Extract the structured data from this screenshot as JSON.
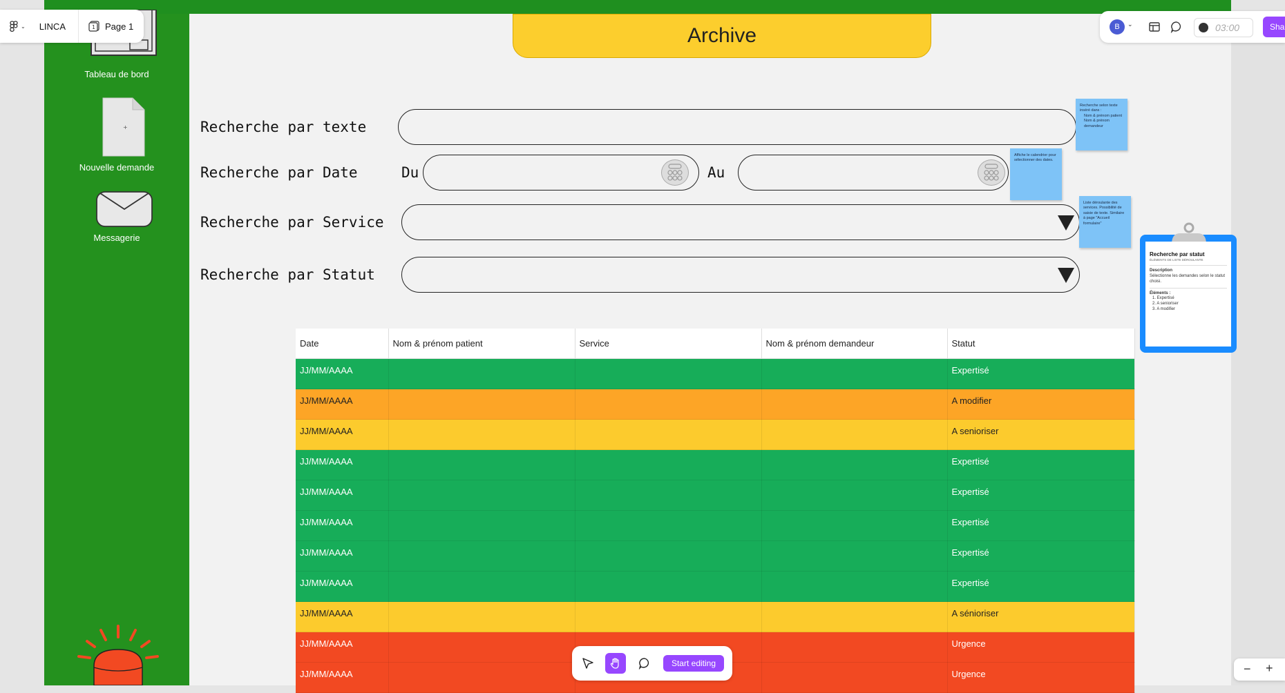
{
  "app": {
    "file_name": "LINCA",
    "page_name": "Page 1",
    "avatar_initial": "B",
    "timer": "03:00",
    "share_label": "Share",
    "start_editing_label": "Start editing"
  },
  "sidebar": {
    "items": [
      {
        "label": "Tableau de bord"
      },
      {
        "label": "Nouvelle demande"
      },
      {
        "label": "Messagerie"
      }
    ]
  },
  "page": {
    "title": "Archive"
  },
  "search": {
    "text_label": "Recherche par texte",
    "date_label": "Recherche par Date",
    "date_from": "Du",
    "date_to": "Au",
    "service_label": "Recherche par Service",
    "status_label": "Recherche par Statut"
  },
  "notes": {
    "text_note": {
      "title": "Recherche selon texte inséré dans :",
      "items": [
        "Nom & prénom patient",
        "Nom & prénom demandeur"
      ]
    },
    "date_note": {
      "text": "Affiche le calendrier pour sélectionner des dates."
    },
    "service_note": {
      "text": "Liste déroulante des services. Possibilité de saisie de texte. Similaire à page \"Accueil formulaire\""
    }
  },
  "clipboard": {
    "title": "Recherche par statut",
    "subtitle": "ÉLÉMENTS DE LISTE DÉROULANTE",
    "description_heading": "Description",
    "description": "Sélectionne les demandes selon le statut choisi.",
    "elements_heading": "Éléments :",
    "elements": [
      "1. Expertisé",
      "2. A senioriser",
      "3. A modifier"
    ]
  },
  "table": {
    "headers": [
      "Date",
      "Nom & prénom patient",
      "Service",
      "Nom & prénom demandeur",
      "Statut"
    ],
    "rows": [
      {
        "date": "JJ/MM/AAAA",
        "statut": "Expertisé",
        "kind": "expertise"
      },
      {
        "date": "JJ/MM/AAAA",
        "statut": "A modifier",
        "kind": "modifier"
      },
      {
        "date": "JJ/MM/AAAA",
        "statut": "A senioriser",
        "kind": "senior"
      },
      {
        "date": "JJ/MM/AAAA",
        "statut": "Expertisé",
        "kind": "expertise"
      },
      {
        "date": "JJ/MM/AAAA",
        "statut": "Expertisé",
        "kind": "expertise"
      },
      {
        "date": "JJ/MM/AAAA",
        "statut": "Expertisé",
        "kind": "expertise"
      },
      {
        "date": "JJ/MM/AAAA",
        "statut": "Expertisé",
        "kind": "expertise"
      },
      {
        "date": "JJ/MM/AAAA",
        "statut": "Expertisé",
        "kind": "expertise"
      },
      {
        "date": "JJ/MM/AAAA",
        "statut": "A sénioriser",
        "kind": "senior"
      },
      {
        "date": "JJ/MM/AAAA",
        "statut": "Urgence",
        "kind": "urgence"
      },
      {
        "date": "JJ/MM/AAAA",
        "statut": "Urgence",
        "kind": "urgence"
      }
    ]
  },
  "colors": {
    "sidebar_green": "#24911e",
    "title_yellow": "#fcce2d",
    "row_green": "#17ad59",
    "row_orange": "#fda526",
    "row_yellow": "#fccb2d",
    "row_red": "#f24922",
    "note_blue": "#7ec3f7",
    "accent_purple": "#9747ff"
  }
}
